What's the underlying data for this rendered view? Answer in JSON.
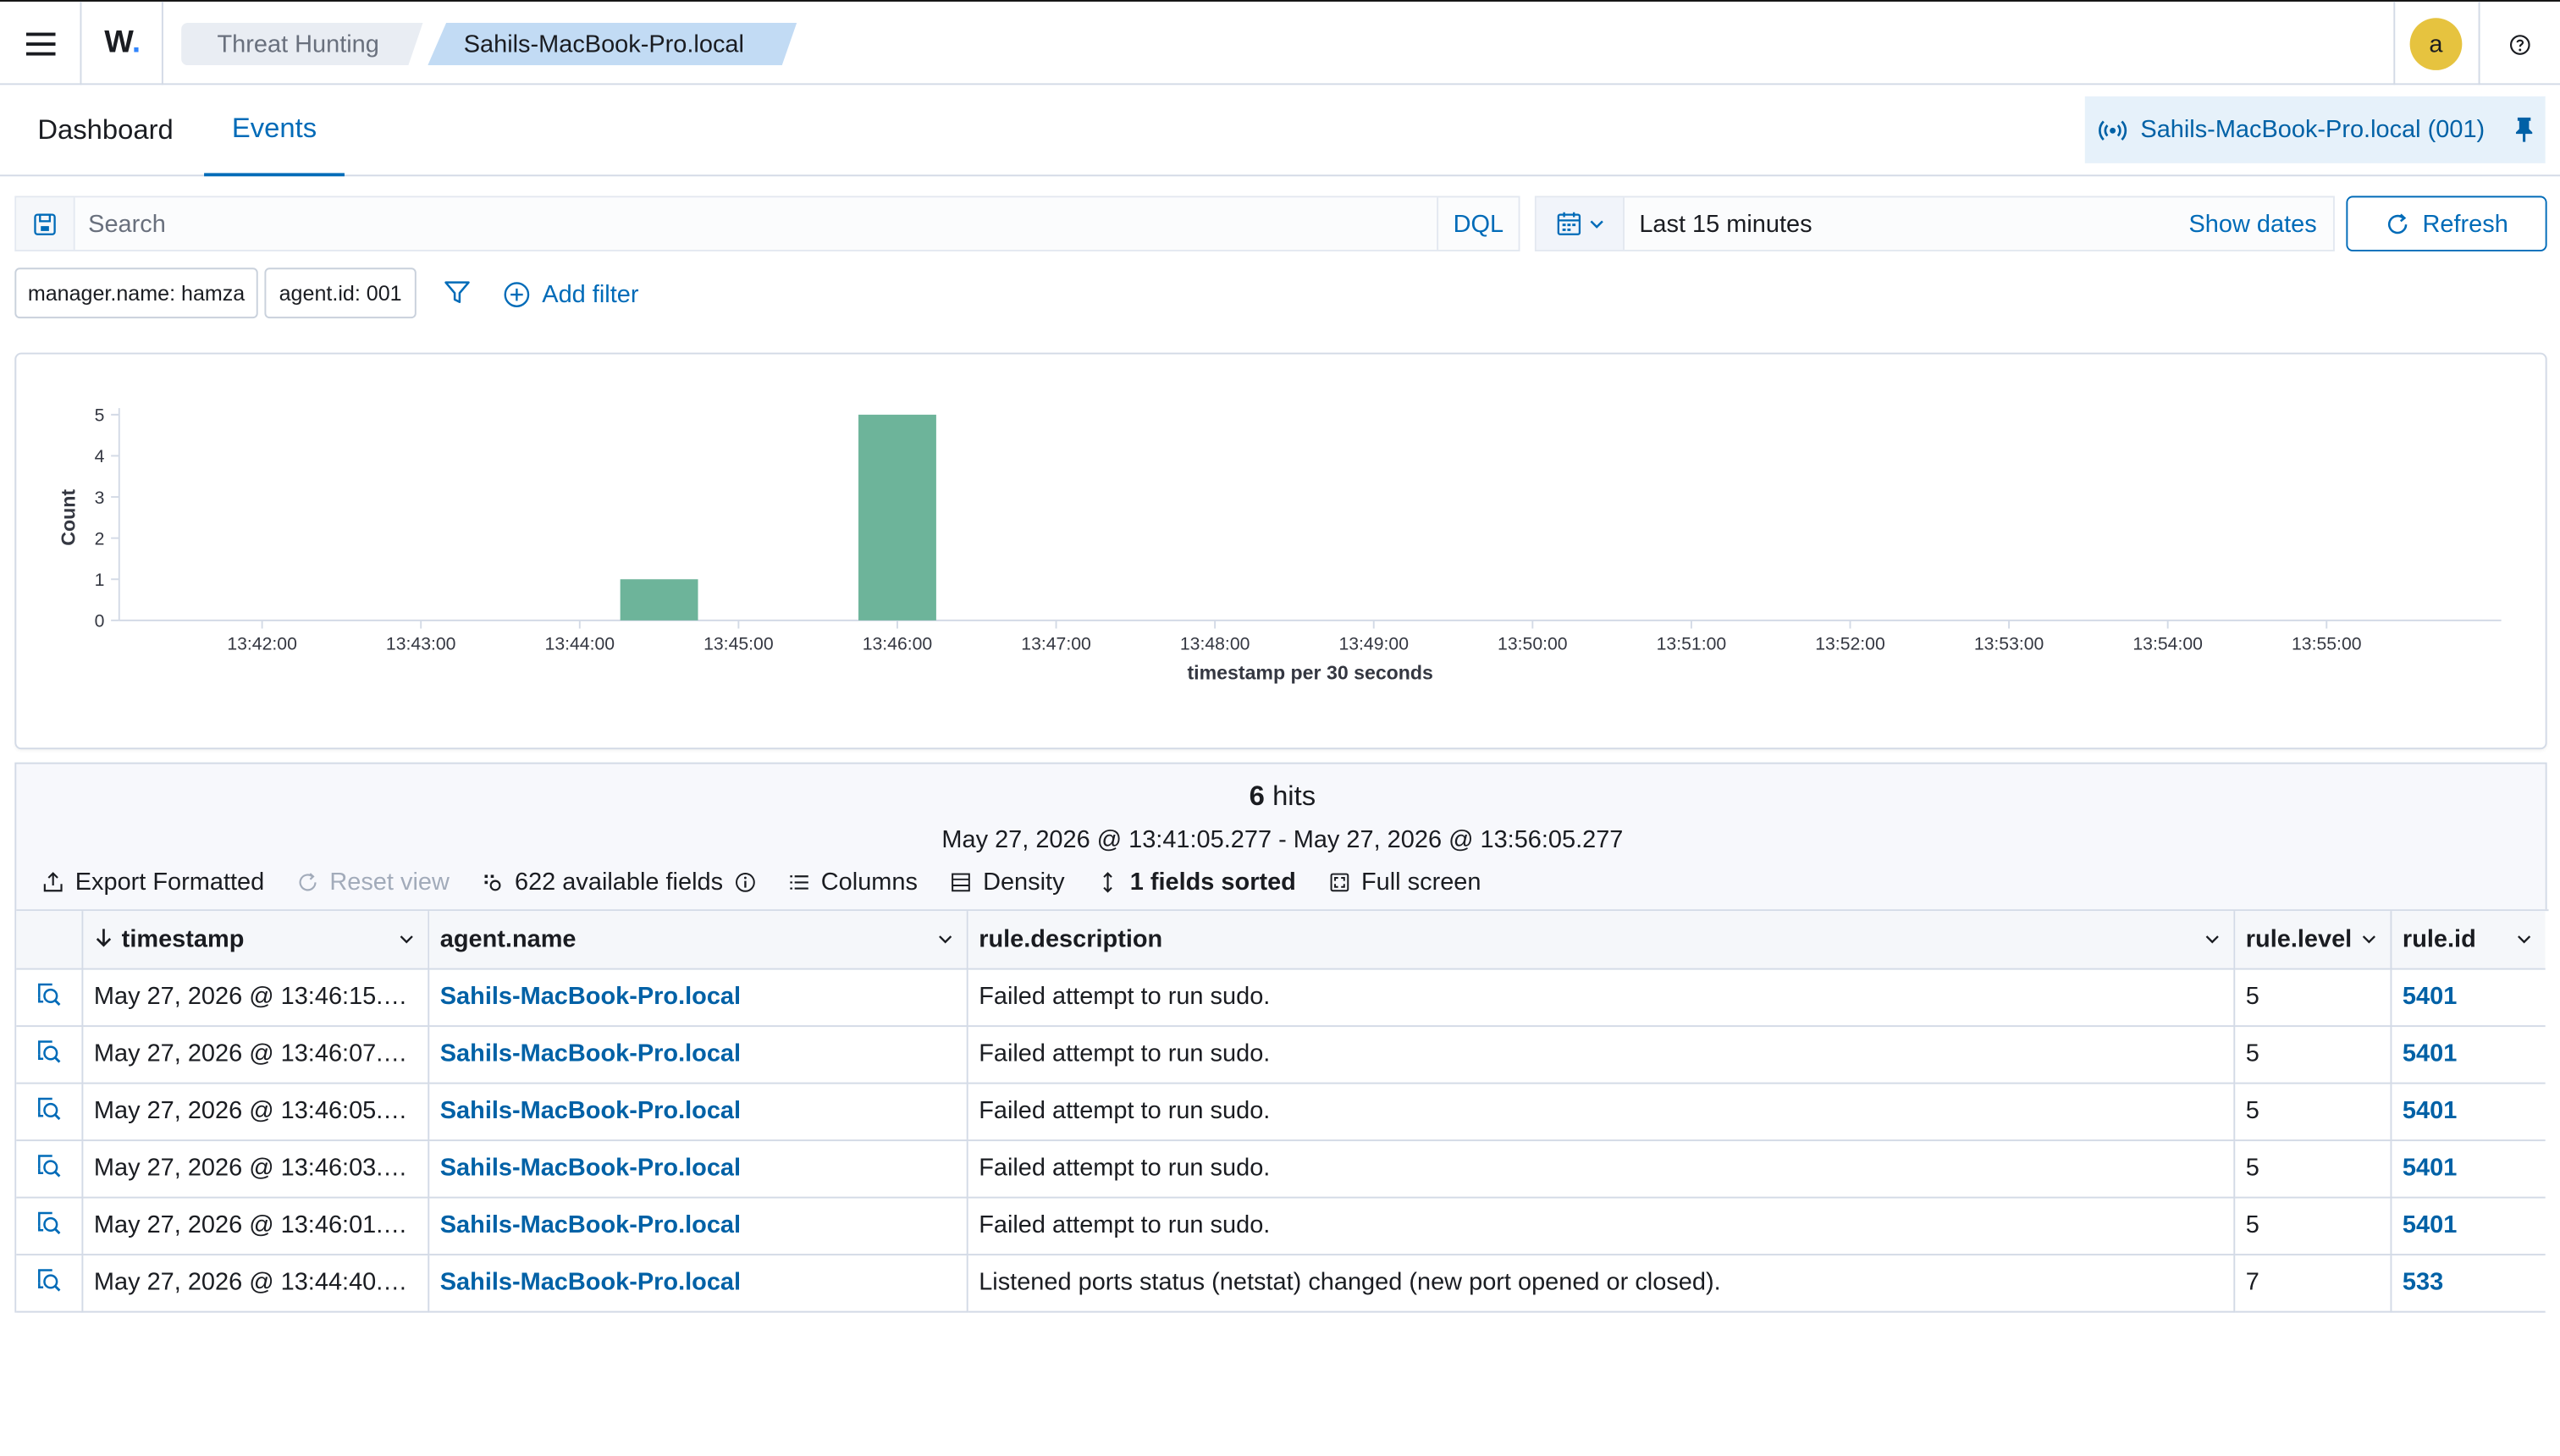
{
  "header": {
    "logo": "W",
    "breadcrumbs": [
      "Threat Hunting",
      "Sahils-MacBook-Pro.local"
    ],
    "avatar": "a"
  },
  "tabs": [
    {
      "label": "Dashboard",
      "active": false
    },
    {
      "label": "Events",
      "active": true
    }
  ],
  "agent_pill": {
    "label": "Sahils-MacBook-Pro.local (001)"
  },
  "search": {
    "placeholder": "Search",
    "value": "",
    "language": "DQL"
  },
  "datepicker": {
    "range": "Last 15 minutes",
    "show_dates": "Show dates",
    "refresh": "Refresh"
  },
  "filters": [
    {
      "label": "manager.name: hamza"
    },
    {
      "label": "agent.id: 001"
    }
  ],
  "add_filter": "Add filter",
  "chart_data": {
    "type": "bar",
    "xlabel": "timestamp per 30 seconds",
    "ylabel": "Count",
    "ylim": [
      0,
      5
    ],
    "yticks": [
      0,
      1,
      2,
      3,
      4,
      5
    ],
    "xticks": [
      "13:42:00",
      "13:43:00",
      "13:44:00",
      "13:45:00",
      "13:46:00",
      "13:47:00",
      "13:48:00",
      "13:49:00",
      "13:50:00",
      "13:51:00",
      "13:52:00",
      "13:53:00",
      "13:54:00",
      "13:55:00"
    ],
    "bars": [
      {
        "x": "13:44:30",
        "value": 1
      },
      {
        "x": "13:46:00",
        "value": 5
      }
    ],
    "color": "#6db49a",
    "grid": false,
    "legend": "none"
  },
  "results": {
    "hits_count": "6",
    "hits_label": "hits",
    "range": "May 27, 2026 @ 13:41:05.277 - May 27, 2026 @ 13:56:05.277",
    "toolbar": {
      "export": "Export Formatted",
      "reset": "Reset view",
      "fields": "622 available fields",
      "columns": "Columns",
      "density": "Density",
      "sorted": "1 fields sorted",
      "fullscreen": "Full screen"
    },
    "columns": [
      "timestamp",
      "agent.name",
      "rule.description",
      "rule.level",
      "rule.id"
    ],
    "rows": [
      {
        "timestamp": "May 27, 2026 @ 13:46:15.0...",
        "agent": "Sahils-MacBook-Pro.local",
        "description": "Failed attempt to run sudo.",
        "level": "5",
        "rule_id": "5401"
      },
      {
        "timestamp": "May 27, 2026 @ 13:46:07.0...",
        "agent": "Sahils-MacBook-Pro.local",
        "description": "Failed attempt to run sudo.",
        "level": "5",
        "rule_id": "5401"
      },
      {
        "timestamp": "May 27, 2026 @ 13:46:05.0...",
        "agent": "Sahils-MacBook-Pro.local",
        "description": "Failed attempt to run sudo.",
        "level": "5",
        "rule_id": "5401"
      },
      {
        "timestamp": "May 27, 2026 @ 13:46:03.0...",
        "agent": "Sahils-MacBook-Pro.local",
        "description": "Failed attempt to run sudo.",
        "level": "5",
        "rule_id": "5401"
      },
      {
        "timestamp": "May 27, 2026 @ 13:46:01.0...",
        "agent": "Sahils-MacBook-Pro.local",
        "description": "Failed attempt to run sudo.",
        "level": "5",
        "rule_id": "5401"
      },
      {
        "timestamp": "May 27, 2026 @ 13:44:40.8...",
        "agent": "Sahils-MacBook-Pro.local",
        "description": "Listened ports status (netstat) changed (new port opened or closed).",
        "level": "7",
        "rule_id": "533"
      }
    ]
  }
}
